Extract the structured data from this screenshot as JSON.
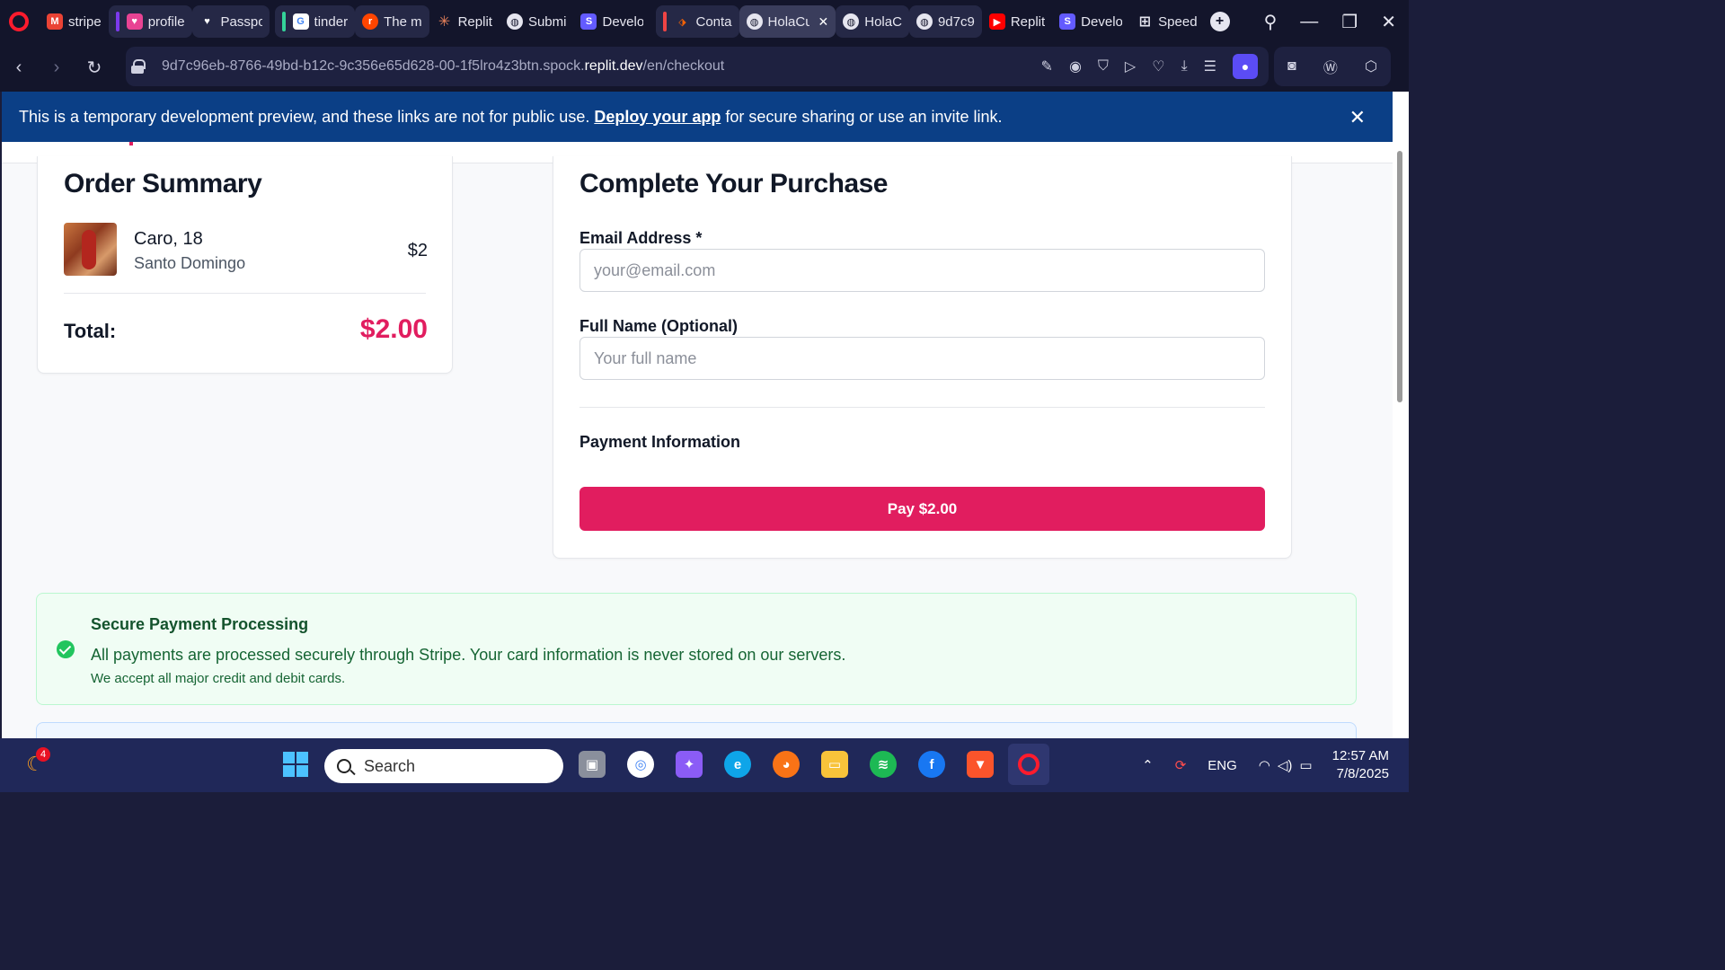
{
  "browser": {
    "tabs": [
      {
        "label": "stripe",
        "icon": "gmail-icon"
      },
      {
        "label": "profile",
        "icon": "heart-app-icon"
      },
      {
        "label": "Passpo",
        "icon": "heart-icon"
      },
      {
        "label": "tinder",
        "icon": "google-icon"
      },
      {
        "label": "The m",
        "icon": "reddit-icon"
      },
      {
        "label": "Replit",
        "icon": "claude-icon"
      },
      {
        "label": "Submi",
        "icon": "globe-icon"
      },
      {
        "label": "Develo",
        "icon": "stripe-icon"
      },
      {
        "label": "Conta",
        "icon": "replit-icon"
      },
      {
        "label": "HolaCup",
        "icon": "globe-icon",
        "active": true
      },
      {
        "label": "HolaC",
        "icon": "globe-icon"
      },
      {
        "label": "9d7c9",
        "icon": "globe-icon"
      },
      {
        "label": "Replit",
        "icon": "youtube-icon"
      },
      {
        "label": "Develo",
        "icon": "stripe-icon"
      },
      {
        "label": "Speed",
        "icon": "speed-dial-icon"
      }
    ],
    "url_prefix": "9d7c96eb-8766-49bd-b12c-9c356e65d628-00-1f5lro4z3btn.spock.",
    "url_domain": "replit.dev",
    "url_path": "/en/checkout"
  },
  "banner": {
    "text_before": "This is a temporary development preview, and these links are not for public use.",
    "link": "Deploy your app",
    "text_after": "for secure sharing or use an invite link."
  },
  "order": {
    "title": "Order Summary",
    "item_name": "Caro, 18",
    "item_location": "Santo Domingo",
    "item_price": "$2",
    "total_label": "Total:",
    "total_value": "$2.00"
  },
  "purchase": {
    "title": "Complete Your Purchase",
    "email_label": "Email Address *",
    "email_placeholder": "your@email.com",
    "name_label": "Full Name (Optional)",
    "name_placeholder": "Your full name",
    "payment_label": "Payment Information",
    "pay_button": "Pay $2.00"
  },
  "secure": {
    "title": "Secure Payment Processing",
    "text": "All payments are processed securely through Stripe. Your card information is never stored on our servers.",
    "subtext": "We accept all major credit and debit cards."
  },
  "taskbar": {
    "search_placeholder": "Search",
    "notification_count": "4",
    "language": "ENG",
    "time": "12:57 AM",
    "date": "7/8/2025"
  },
  "colors": {
    "accent": "#e11d5f",
    "banner": "#0b3f86",
    "success": "#22c55e"
  }
}
